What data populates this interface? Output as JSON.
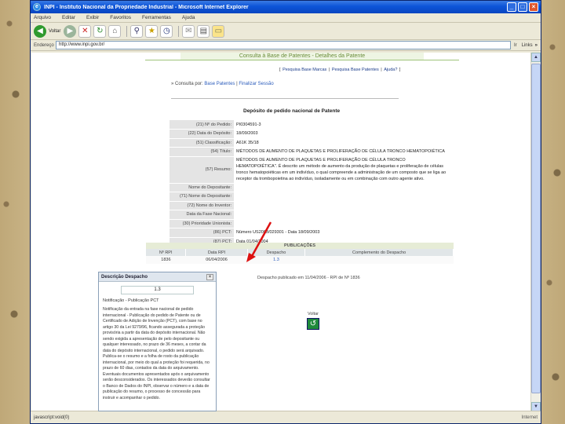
{
  "window": {
    "title": "INPI - Instituto Nacional da Propriedade Industrial - Microsoft Internet Explorer"
  },
  "menu": [
    "Arquivo",
    "Editar",
    "Exibir",
    "Favoritos",
    "Ferramentas",
    "Ajuda"
  ],
  "toolbar": {
    "back_label": "Voltar"
  },
  "address": {
    "label": "Endereço",
    "url": "http://www.inpi.gov.br/",
    "go_label": "Ir",
    "links_label": "Links"
  },
  "page": {
    "title": "Consulta à Base de Patentes - Detalhes da Patente",
    "quick_links": [
      "Pesquisa Base Marcas",
      "Pesquisa Base Patentes",
      "Ajuda?"
    ],
    "breadcrumb_prefix": "» Consulta por:",
    "breadcrumb_links": [
      "Base Patentes",
      "Finalizar Sessão"
    ],
    "section_heading": "Depósito de pedido nacional de Patente",
    "details": [
      {
        "key": "(21) Nº do Pedido:",
        "value": "PI0304591-3"
      },
      {
        "key": "(22) Data do Depósito:",
        "value": "18/09/2003"
      },
      {
        "key": "(51) Classificação:",
        "value": "A61K 35/18"
      },
      {
        "key": "(54) Título:",
        "value": "MÉTODOS DE AUMENTO DE PLAQUETAS E PROLIFERAÇÃO DE CÉLULA TRONCO HEMATOPOIÉTICA"
      },
      {
        "key": "(57) Resumo:",
        "value": "MÉTODOS DE AUMENTO DE PLAQUETAS E PROLIFERAÇÃO DE CÉLULA TRONCO HEMATOPOIÉTICA\". É descrito um método de aumento da produção de plaquetas e proliferação de células tronco hematopoiéticas em um indivíduo, o qual compreende a administração de um composto que se liga ao receptor da trombopoietina ao indivíduo, isoladamente ou em combinação com outro agente ativo."
      },
      {
        "key": "Nome do Depositante:",
        "value": ""
      },
      {
        "key": "(71) Nome do Depositante:",
        "value": ""
      },
      {
        "key": "(72) Nome do Inventor:",
        "value": ""
      },
      {
        "key": "Data da Fase Nacional:",
        "value": ""
      },
      {
        "key": "(30) Prioridade Unionista:",
        "value": ""
      },
      {
        "key": "(86) PCT:",
        "value": "Número US2003/029301 - Data 18/09/2003"
      },
      {
        "key": "(87) PCT:",
        "value": "Data 01/04/2004"
      }
    ],
    "publications": {
      "heading": "PUBLICAÇÕES",
      "columns": [
        "Nº RPI",
        "Data RPI",
        "Despacho",
        "Complemento do Despacho"
      ],
      "rows": [
        {
          "rpi": "1836",
          "data": "06/04/2006",
          "despacho": "1.3",
          "complemento": ""
        }
      ]
    },
    "despacho_note": "Despacho publicado em 11/04/2006 - RPI de Nº 1836",
    "voltar_label": "Voltar"
  },
  "modal": {
    "title": "Descrição Despacho",
    "code": "1.3",
    "subtitle": "Notificação - Publicação PCT",
    "body": "Notificação da entrada na fase nacional de pedido internacional - Publicação do pedido de Patente ou de Certificado de Adição de Invenção (PCT), com base no artigo 30 da Lei 9279/96, ficando assegurada a proteção provisória a partir da data do depósito internacional. Não sendo exigida a apresentação de pelo depositante ou qualquer interessado, no prazo de 36 meses, a contar da data do depósito internacional, o pedido será arquivado. Publica-se o resumo e a folha de rosto da publicação internacional, por meio do qual a proteção foi requerida, no prazo de 60 dias, contados da data do arquivamento. Eventuais documentos apresentados após o arquivamento serão desconsiderados. Os interessados deverão consultar o Banco de Dados do INPI, observar o número e a data de publicação do resumo, o processo de concessão para instruir e acompanhar o pedido."
  },
  "status": {
    "left": "javascript:void(0)",
    "zone": "Internet"
  }
}
